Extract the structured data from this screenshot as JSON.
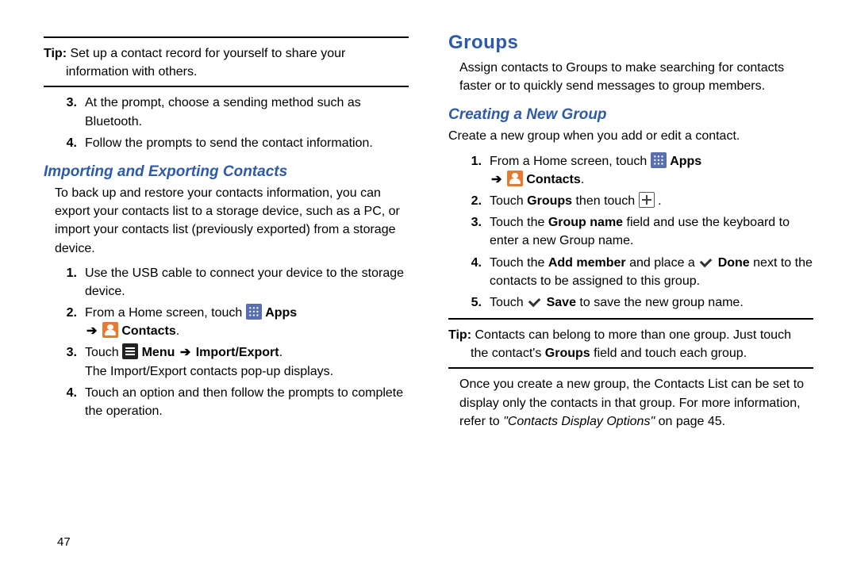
{
  "pageNumber": "47",
  "left": {
    "tip": {
      "label": "Tip:",
      "line1": "Set up a contact record for yourself to share your",
      "line2": "information with others."
    },
    "stepsA": [
      {
        "num": "3.",
        "text": "At the prompt, choose a sending method such as Bluetooth."
      },
      {
        "num": "4.",
        "text": "Follow the prompts to send the contact information."
      }
    ],
    "section": "Importing and Exporting Contacts",
    "intro": "To back up and restore your contacts information, you can export your contacts list to a storage device, such as a PC, or import your contacts list (previously exported) from a storage device.",
    "stepsB": {
      "s1": {
        "num": "1.",
        "text": "Use the USB cable to connect your device to the storage device."
      },
      "s2": {
        "num": "2.",
        "pre": "From a Home screen, touch ",
        "apps": "Apps",
        "arrow": "➔",
        "contacts": "Contacts",
        "period": "."
      },
      "s3": {
        "num": "3.",
        "touch": "Touch ",
        "menu": "Menu",
        "arrow": "➔",
        "ie": "Import/Export",
        "period": ".",
        "line2": "The Import/Export contacts pop-up displays."
      },
      "s4": {
        "num": "4.",
        "text": "Touch an option and then follow the prompts to complete the operation."
      }
    }
  },
  "right": {
    "heading": "Groups",
    "intro": "Assign contacts to Groups to make searching for contacts faster or to quickly send messages to group members.",
    "section": "Creating a New Group",
    "sectionIntro": "Create a new group when you add or edit a contact.",
    "steps": {
      "s1": {
        "num": "1.",
        "pre": "From a Home screen, touch ",
        "apps": "Apps",
        "arrow": "➔",
        "contacts": "Contacts",
        "period": "."
      },
      "s2": {
        "num": "2.",
        "pre": "Touch ",
        "groups": "Groups",
        "mid": "  then touch ",
        "period": "."
      },
      "s3": {
        "num": "3.",
        "pre": "Touch the ",
        "gn": "Group name",
        "post": " field and use the keyboard to enter a new Group name."
      },
      "s4": {
        "num": "4.",
        "pre": "Touch the ",
        "am": "Add member",
        "mid": " and place a ",
        "done": "Done",
        "post": " next to the contacts to be assigned to this group."
      },
      "s5": {
        "num": "5.",
        "pre": "Touch ",
        "save": "Save",
        "post": " to save the new group name."
      }
    },
    "tip": {
      "label": "Tip:",
      "line1": "Contacts can belong to more than one group. Just touch",
      "line2a": "the contact's ",
      "line2b": "Groups",
      "line2c": " field and touch each group."
    },
    "outro": {
      "pre": "Once you create a new group, the Contacts List can be set to display only the contacts in that group. For more information, refer to ",
      "ref": "\"Contacts Display Options\"",
      "post": " on page 45."
    }
  }
}
